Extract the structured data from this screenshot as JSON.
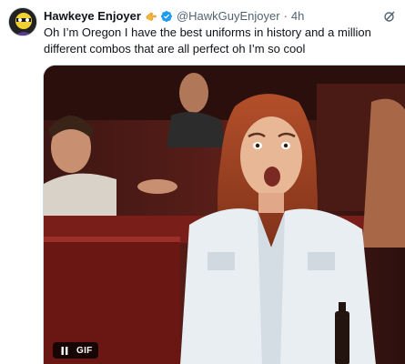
{
  "author": {
    "display_name": "Hawkeye Enjoyer",
    "handle": "@HawkGuyEnjoyer",
    "separator": "·",
    "timestamp": "4h",
    "verified": true,
    "emoji": "pointing-hand-emoji"
  },
  "tweet": {
    "text": "Oh I’m Oregon I have the best uniforms in history and a million different combos that are all perfect oh I’m so cool"
  },
  "media": {
    "type": "gif",
    "badge_label": "GIF",
    "playing": true
  },
  "icons": {
    "more": "grok-icon",
    "verified": "verified-badge-icon",
    "pause": "pause-icon"
  },
  "colors": {
    "verified_blue": "#1d9bf0",
    "text_primary": "#0f1419",
    "text_secondary": "#536471"
  }
}
